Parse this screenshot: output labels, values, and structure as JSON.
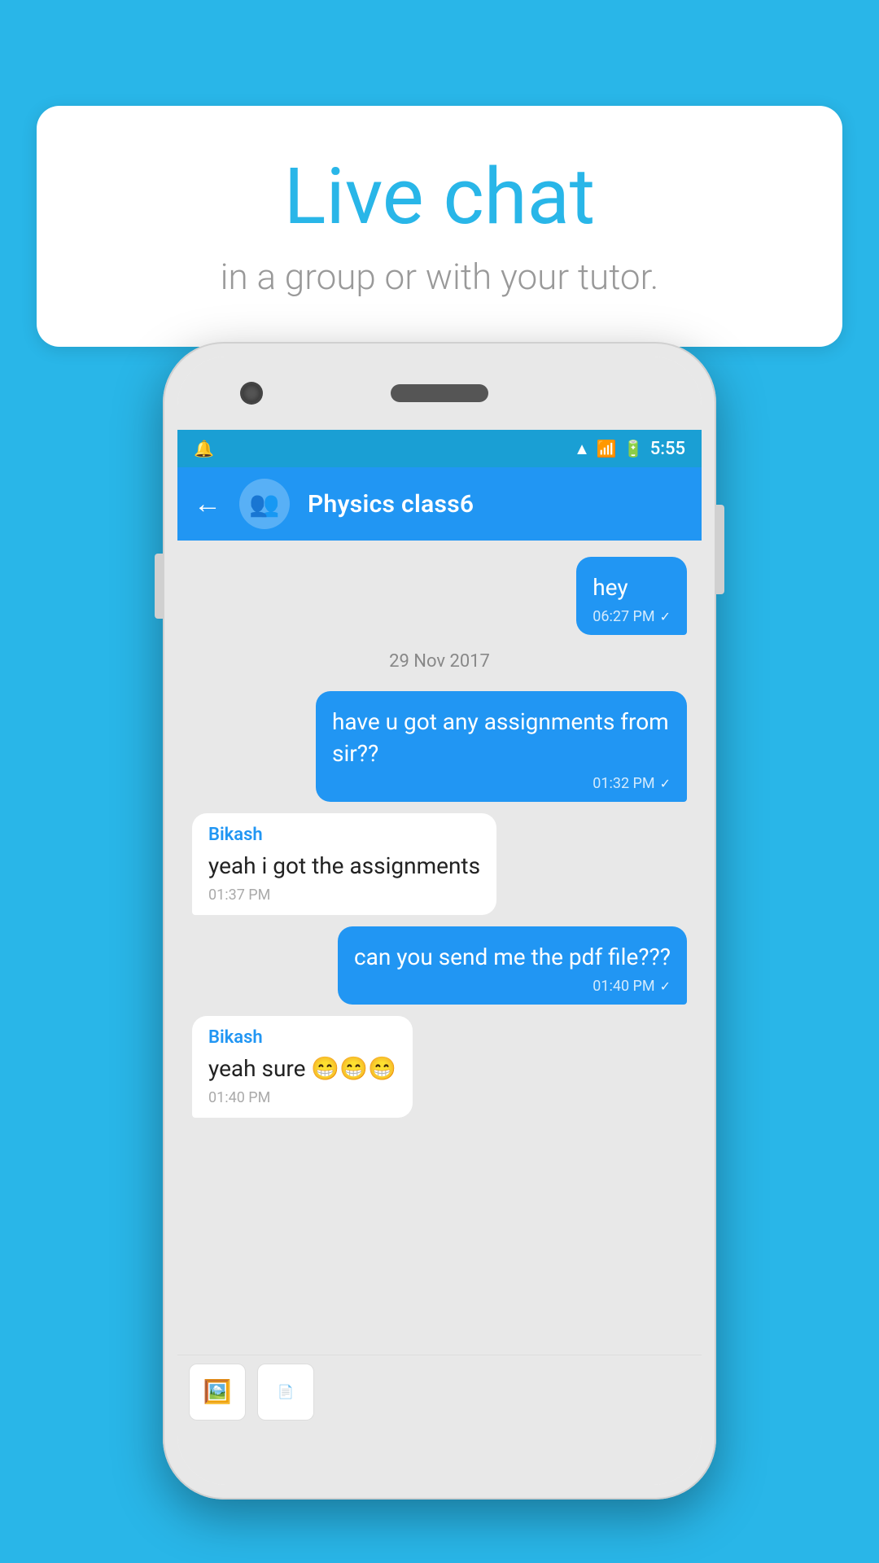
{
  "background_color": "#29b6e8",
  "speech_bubble": {
    "title": "Live chat",
    "subtitle": "in a group or with your tutor."
  },
  "phone": {
    "status_bar": {
      "time": "5:55",
      "icons": [
        "notif",
        "wifi",
        "signal",
        "battery"
      ]
    },
    "app_bar": {
      "title": "Physics class6",
      "back_label": "←"
    },
    "messages": [
      {
        "type": "outgoing",
        "text": "hey",
        "time": "06:27 PM",
        "checked": true
      },
      {
        "type": "date_divider",
        "text": "29  Nov  2017"
      },
      {
        "type": "outgoing",
        "text": "have u got any assignments from sir??",
        "time": "01:32 PM",
        "checked": true
      },
      {
        "type": "incoming",
        "sender": "Bikash",
        "text": "yeah i got the assignments",
        "time": "01:37 PM"
      },
      {
        "type": "outgoing",
        "text": "can you send me the pdf file???",
        "time": "01:40 PM",
        "checked": true
      },
      {
        "type": "incoming",
        "sender": "Bikash",
        "text": "yeah sure 😁😁😁",
        "time": "01:40 PM"
      }
    ],
    "input_bar": {
      "attach_image_icon": "🖼",
      "attach_doc_icon": "📄"
    }
  }
}
